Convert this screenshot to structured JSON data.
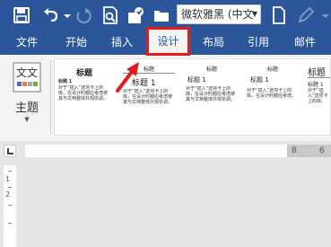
{
  "colors": {
    "accent": "#2b579a",
    "highlight_box": "#e21b1b",
    "arrow": "#e21b1b"
  },
  "quick_access": {
    "icons": [
      "save-icon",
      "undo-icon",
      "redo-icon",
      "print-preview-icon",
      "format-painter-icon",
      "folder-icon",
      "new-document-icon",
      "pen-icon"
    ],
    "font_name": "微软雅黑 (中文"
  },
  "tabs": [
    {
      "label": "文件"
    },
    {
      "label": "开始"
    },
    {
      "label": "插入"
    },
    {
      "label": "设计"
    },
    {
      "label": "布局"
    },
    {
      "label": "引用"
    },
    {
      "label": "邮件"
    }
  ],
  "ribbon": {
    "theme_button": {
      "label": "主题",
      "icon_text": "文文"
    },
    "style_thumbs": [
      {
        "title": "标题",
        "heading": "标题 1",
        "body": "对于“插入”选项卡上的库，在设计时都应考虑使其与文档整体外观协调。"
      },
      {
        "title": "标题",
        "heading": "标题 1",
        "body": "对于“插入”选项卡上的库，在设计时都应考虑使其与文档整体外观协调。"
      },
      {
        "title": "标题",
        "heading": "标题 1",
        "body": "对于“插入”选项卡上的库，在设计时都应考虑使其与文档整体外观协调。"
      },
      {
        "title": "标题",
        "heading": "标题 1",
        "body": "对于“插入”选项卡上的库，在设计时都应考虑。"
      },
      {
        "title": "标题",
        "heading": "标题 1",
        "body": "对于“插入”选项卡上的库。"
      }
    ]
  },
  "ruler": {
    "h_numbers": [
      "8",
      "6"
    ],
    "v_numbers": [
      "1",
      "2"
    ]
  }
}
